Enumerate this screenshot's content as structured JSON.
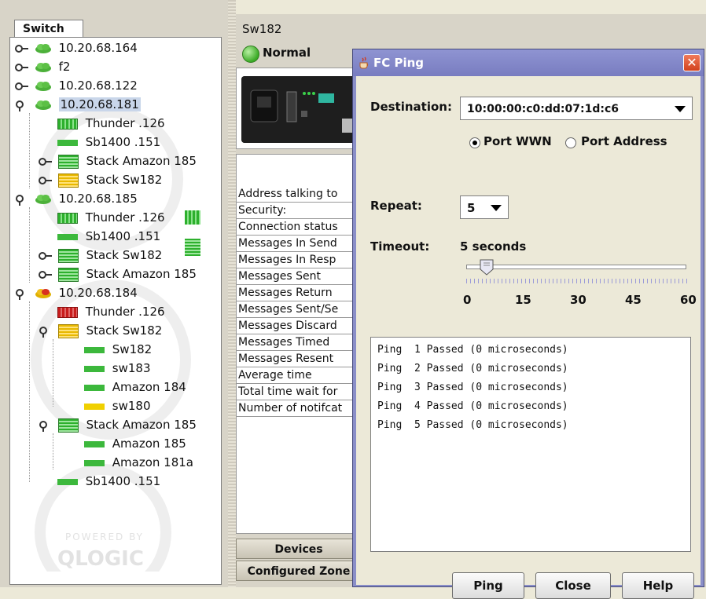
{
  "left_panel": {
    "tab_label": "Switch",
    "watermark": "POWERED BY QLOGIC",
    "tree": [
      {
        "label": "10.20.68.164"
      },
      {
        "label": "f2"
      },
      {
        "label": "10.20.68.122"
      },
      {
        "label": "10.20.68.181"
      },
      {
        "label": "Thunder .126"
      },
      {
        "label": "Sb1400 .151"
      },
      {
        "label": "Stack Amazon 185"
      },
      {
        "label": "Stack Sw182"
      },
      {
        "label": "10.20.68.185"
      },
      {
        "label": "Thunder .126"
      },
      {
        "label": "Sb1400 .151"
      },
      {
        "label": "Stack Sw182"
      },
      {
        "label": "Stack Amazon 185"
      },
      {
        "label": "10.20.68.184"
      },
      {
        "label": "Thunder .126"
      },
      {
        "label": "Stack Sw182"
      },
      {
        "label": "Sw182"
      },
      {
        "label": "sw183"
      },
      {
        "label": "Amazon 184"
      },
      {
        "label": "sw180"
      },
      {
        "label": "Stack Amazon 185"
      },
      {
        "label": "Amazon 185"
      },
      {
        "label": "Amazon 181a"
      },
      {
        "label": "Sb1400 .151"
      }
    ]
  },
  "right_panel": {
    "switch_name": "Sw182",
    "status": "Normal",
    "info_rows": [
      "Address talking to",
      "Security:",
      "Connection status",
      "Messages In Send",
      "Messages In Resp",
      "Messages Sent",
      "Messages Return",
      "Messages Sent/Se",
      "Messages Discard",
      "Messages Timed",
      "Messages Resent",
      "Average time",
      "Total time wait for",
      "Number of notifcat"
    ],
    "bottom_tabs": [
      "Devices",
      "Configured Zone"
    ]
  },
  "dialog": {
    "title": "FC Ping",
    "close_glyph": "✕",
    "destination_label": "Destination:",
    "destination_value": "10:00:00:c0:dd:07:1d:c6",
    "radio_port_wwn": "Port WWN",
    "radio_port_address": "Port Address",
    "radio_selected": "port_wwn",
    "repeat_label": "Repeat:",
    "repeat_value": "5",
    "timeout_label": "Timeout:",
    "timeout_value": "5 seconds",
    "slider_value": 5,
    "slider_min": 0,
    "slider_max": 60,
    "slider_ticks": [
      "0",
      "15",
      "30",
      "45",
      "60"
    ],
    "results": [
      "Ping  1 Passed (0 microseconds)",
      "Ping  2 Passed (0 microseconds)",
      "Ping  3 Passed (0 microseconds)",
      "Ping  4 Passed (0 microseconds)",
      "Ping  5 Passed (0 microseconds)"
    ],
    "buttons": {
      "ping": "Ping",
      "close": "Close",
      "help": "Help"
    }
  },
  "colors": {
    "dialog_frame": "#8a8ec8",
    "status_ok": "#3aaa25",
    "device_ok": "#2db02d",
    "device_warn": "#e8b800",
    "device_fail": "#c81d1d"
  }
}
